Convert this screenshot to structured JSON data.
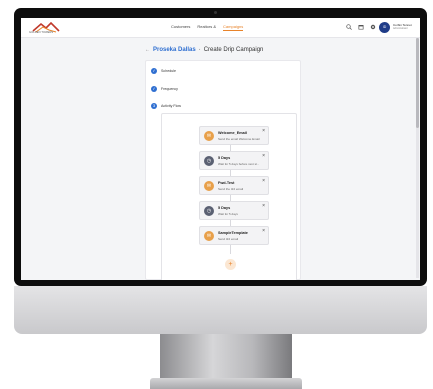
{
  "header": {
    "logo_text": "GOLDEN TOWERS",
    "nav": [
      "Customers",
      "Realtors &",
      "Campaigns"
    ],
    "active_nav_index": 2,
    "icons": [
      "search-icon",
      "calendar-icon",
      "gear-icon"
    ],
    "user": {
      "initials": "ID",
      "name": "Corbin Tennet",
      "role": "Administrator"
    }
  },
  "breadcrumb": {
    "back": "←",
    "parent": "Proseka Dallas",
    "separator": "·",
    "title": "Create Drip Campaign"
  },
  "steps": [
    {
      "label": "Schedule"
    },
    {
      "label": "Frequency"
    },
    {
      "label": "Activity Flow"
    }
  ],
  "flow_nodes": [
    {
      "title": "Welcome_Email",
      "subtitle": "Send the email Welcome Email",
      "icon": "mail-icon",
      "color": "#e8a04a"
    },
    {
      "title": "5 Days",
      "subtitle": "Wait for 5 days before next st...",
      "icon": "clock-icon",
      "color": "#5a6072"
    },
    {
      "title": "Fwd-Test",
      "subtitle": "Send the 3rd email",
      "icon": "mail-icon",
      "color": "#e8a04a"
    },
    {
      "title": "5 Days",
      "subtitle": "Wait for 5 days",
      "icon": "clock-icon",
      "color": "#5a6072"
    },
    {
      "title": "SampleTemplate",
      "subtitle": "Send 3rd email",
      "icon": "mail-icon",
      "color": "#e8a04a"
    }
  ],
  "add_step_symbol": "+",
  "colors": {
    "accent": "#e8832a",
    "link": "#2f6fd1"
  }
}
